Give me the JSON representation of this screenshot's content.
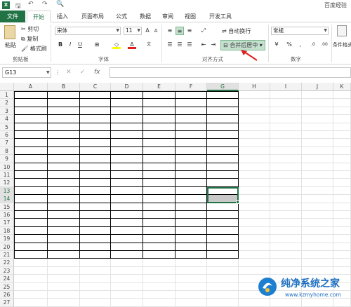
{
  "title": "百度经验",
  "tabs": [
    "文件",
    "开始",
    "插入",
    "页面布局",
    "公式",
    "数据",
    "审阅",
    "视图",
    "开发工具"
  ],
  "clipboard": {
    "paste": "粘贴",
    "cut": "剪切",
    "copy": "复制",
    "format_painter": "格式刷",
    "group": "剪贴板"
  },
  "font": {
    "name": "宋体",
    "size": "11",
    "group": "字体"
  },
  "alignment": {
    "wrap": "自动换行",
    "merge": "合并后居中",
    "group": "对齐方式"
  },
  "number": {
    "format": "常规",
    "group": "数字"
  },
  "styles": {
    "conditional": "条件格式"
  },
  "namebox": "G13",
  "columns": [
    "A",
    "B",
    "C",
    "D",
    "E",
    "F",
    "G",
    "H",
    "I",
    "J",
    "K"
  ],
  "rows": [
    "1",
    "2",
    "3",
    "4",
    "5",
    "6",
    "7",
    "8",
    "9",
    "10",
    "11",
    "12",
    "13",
    "14",
    "15",
    "16",
    "17",
    "18",
    "19",
    "20",
    "21",
    "22",
    "23",
    "24",
    "25",
    "26",
    "27"
  ],
  "watermark": {
    "name": "纯净系统之家",
    "url": "www.kzmyhome.com"
  }
}
